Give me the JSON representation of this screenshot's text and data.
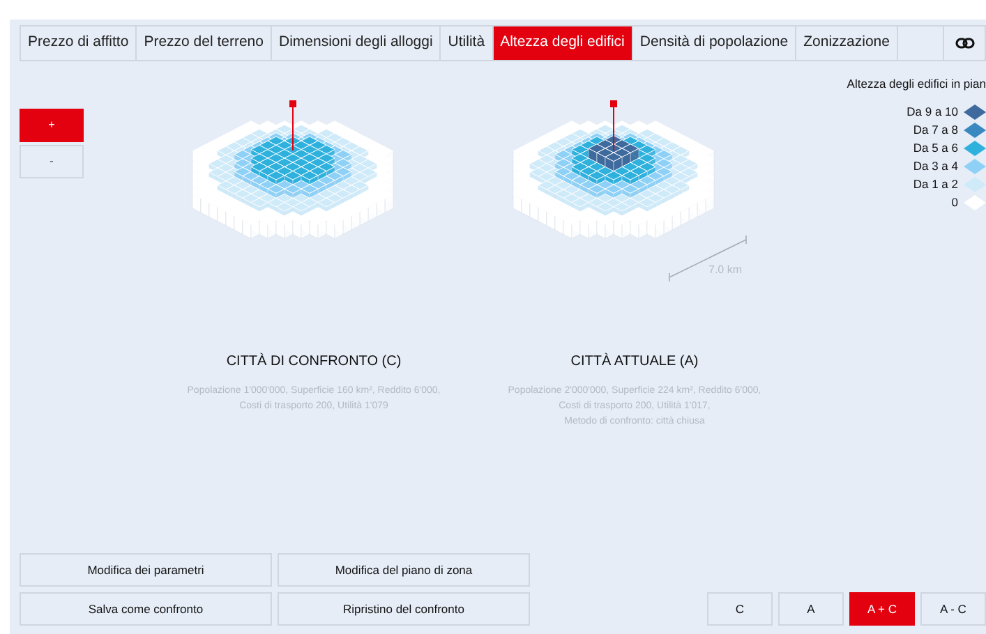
{
  "tabs": [
    {
      "label": "Prezzo di affitto",
      "selected": false
    },
    {
      "label": "Prezzo del terreno",
      "selected": false
    },
    {
      "label": "Dimensioni degli alloggi",
      "selected": false
    },
    {
      "label": "Utilità",
      "selected": false
    },
    {
      "label": "Altezza degli edifici",
      "selected": true
    },
    {
      "label": "Densità di popolazione",
      "selected": false
    },
    {
      "label": "Zonizzazione",
      "selected": false
    }
  ],
  "zoom": [
    {
      "label": "+",
      "selected": true
    },
    {
      "label": "-",
      "selected": false
    }
  ],
  "legend": {
    "title": "Altezza degli edifici in pian",
    "items": [
      {
        "label": "Da 9 a 10",
        "color": "#3e6a9e"
      },
      {
        "label": "Da 7 a 8",
        "color": "#3a88c0"
      },
      {
        "label": "Da 5 a 6",
        "color": "#2fb1de"
      },
      {
        "label": "Da 3 a 4",
        "color": "#8fd1f6"
      },
      {
        "label": "Da 1 a 2",
        "color": "#cfeaf9"
      },
      {
        "label": "0",
        "color": "#ffffff"
      }
    ]
  },
  "cities": [
    {
      "title": "CITTÀ DI CONFRONTO (C)",
      "details": [
        "Popolazione 1'000'000, Superficie 160 km², Reddito 6'000, Costi di trasporto 200, Utilità 1'079"
      ]
    },
    {
      "title": "CITTÀ ATTUALE (A)",
      "scale": "7.0 km",
      "details": [
        "Popolazione 2'000'000, Superficie 224 km², Reddito 6'000, Costi di trasporto 200, Utilità 1'017,",
        "Metodo di confronto: città chiusa"
      ]
    }
  ],
  "actions": [
    "Modifica dei parametri",
    "Modifica del piano di zona",
    "Salva come confronto",
    "Ripristino del confronto"
  ],
  "views": [
    {
      "label": "C",
      "selected": false
    },
    {
      "label": "A",
      "selected": false
    },
    {
      "label": "A + C",
      "selected": true
    },
    {
      "label": "A - C",
      "selected": false
    }
  ]
}
